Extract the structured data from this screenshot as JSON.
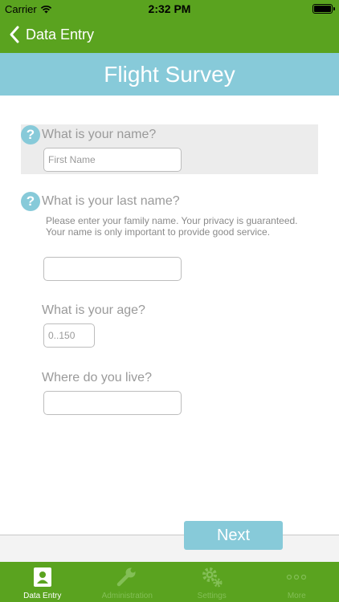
{
  "status_bar": {
    "carrier": "Carrier",
    "time": "2:32 PM"
  },
  "nav": {
    "back_label": "Data Entry"
  },
  "title": "Flight Survey",
  "questions": {
    "name": {
      "label": "What is your name?",
      "placeholder": "First Name",
      "help_glyph": "?"
    },
    "last_name": {
      "label": "What is your last name?",
      "help_glyph": "?",
      "help_text": "Please enter your family name. Your privacy is guaranteed. Your name is only important to provide good service.",
      "value": ""
    },
    "age": {
      "label": "What is your age?",
      "placeholder": "0..150"
    },
    "location": {
      "label": "Where do you live?",
      "value": ""
    }
  },
  "next_label": "Next",
  "tabs": [
    {
      "label": "Data Entry",
      "icon": "contact-card-icon",
      "active": true
    },
    {
      "label": "Administration",
      "icon": "wrench-icon",
      "active": false
    },
    {
      "label": "Settings",
      "icon": "gear-icon",
      "active": false
    },
    {
      "label": "More",
      "icon": "more-dots-icon",
      "active": false
    }
  ],
  "colors": {
    "green": "#5aa31f",
    "blue": "#87cad9",
    "inactive_tab": "#83bf56"
  }
}
